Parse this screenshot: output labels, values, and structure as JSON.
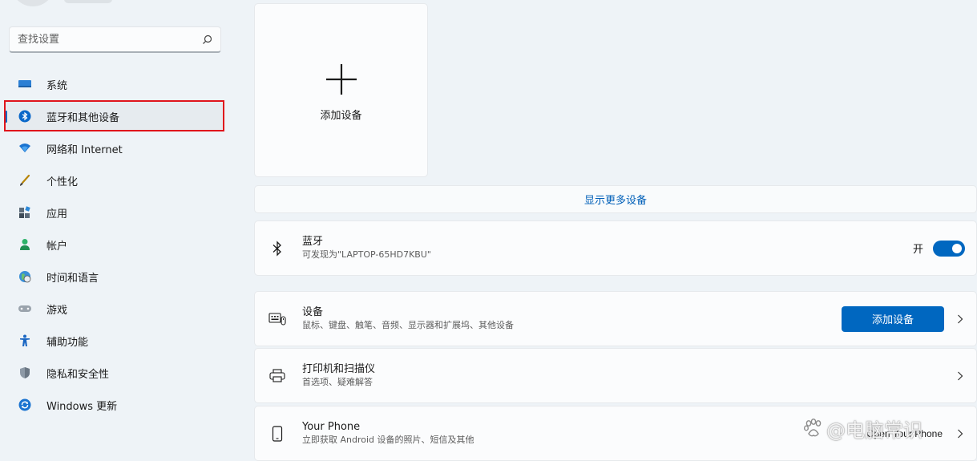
{
  "sidebar": {
    "search": {
      "placeholder": "查找设置"
    },
    "items": [
      {
        "label": "系统",
        "icon": "monitor-icon",
        "active": false
      },
      {
        "label": "蓝牙和其他设备",
        "icon": "bluetooth-icon",
        "active": true
      },
      {
        "label": "网络和 Internet",
        "icon": "wifi-icon",
        "active": false
      },
      {
        "label": "个性化",
        "icon": "brush-icon",
        "active": false
      },
      {
        "label": "应用",
        "icon": "apps-icon",
        "active": false
      },
      {
        "label": "帐户",
        "icon": "person-icon",
        "active": false
      },
      {
        "label": "时间和语言",
        "icon": "globe-clock-icon",
        "active": false
      },
      {
        "label": "游戏",
        "icon": "gamepad-icon",
        "active": false
      },
      {
        "label": "辅助功能",
        "icon": "accessibility-icon",
        "active": false
      },
      {
        "label": "隐私和安全性",
        "icon": "shield-icon",
        "active": false
      },
      {
        "label": "Windows 更新",
        "icon": "update-icon",
        "active": false
      }
    ]
  },
  "main": {
    "add_card": {
      "label": "添加设备"
    },
    "show_more": "显示更多设备",
    "bluetooth": {
      "title": "蓝牙",
      "subtitle": "可发现为\"LAPTOP-65HD7KBU\"",
      "toggle_label": "开",
      "toggle_on": true
    },
    "devices": {
      "title": "设备",
      "subtitle": "鼠标、键盘、触笔、音频、显示器和扩展坞、其他设备",
      "button": "添加设备"
    },
    "printers": {
      "title": "打印机和扫描仪",
      "subtitle": "首选项、疑难解答"
    },
    "phone": {
      "title": "Your Phone",
      "subtitle": "立即获取 Android 设备的照片、短信及其他",
      "link": "Open Your Phone"
    }
  },
  "watermark": {
    "text": "@电脑常识"
  },
  "colors": {
    "accent": "#0067c0",
    "link": "#005fb8",
    "highlight": "#e0151c",
    "background": "#eef3f7"
  }
}
